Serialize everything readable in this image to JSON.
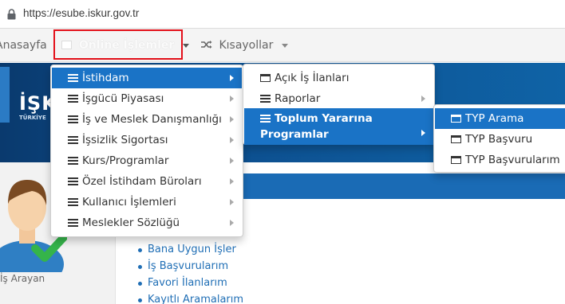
{
  "browser": {
    "url": "https://esube.iskur.gov.tr"
  },
  "navbar": {
    "home_label": "Anasayfa",
    "online_label": "Online İşlemler",
    "shortcuts_label": "Kısayollar"
  },
  "hero": {
    "logo_text": "İŞK",
    "logo_sub": "TÜRKİYE"
  },
  "sidebar": {
    "avatar_label": "İş Arayan"
  },
  "links": [
    "Bana Uygun İşler",
    "İş Başvurularım",
    "Favori İlanlarım",
    "Kayıtlı Aramalarım"
  ],
  "menu1": [
    {
      "label": "İstihdam",
      "active": true
    },
    {
      "label": "İşgücü Piyasası",
      "active": false
    },
    {
      "label": "İş ve Meslek Danışmanlığı",
      "active": false
    },
    {
      "label": "İşsizlik Sigortası",
      "active": false
    },
    {
      "label": "Kurs/Programlar",
      "active": false
    },
    {
      "label": "Özel İstihdam Büroları",
      "active": false
    },
    {
      "label": "Kullanıcı İşlemleri",
      "active": false
    },
    {
      "label": "Meslekler Sözlüğü",
      "active": false
    }
  ],
  "menu2": [
    {
      "label": "Açık İş İlanları"
    },
    {
      "label": "Raporlar"
    },
    {
      "label_line1": "Toplum Yararına",
      "label_line2": "Programlar"
    }
  ],
  "menu3": [
    {
      "label": "TYP Arama"
    },
    {
      "label": "TYP Başvuru"
    },
    {
      "label": "TYP Başvurularım"
    }
  ],
  "colors": {
    "accent": "#1a73c6",
    "highlight_border": "#e3101a",
    "link": "#1f6eb5"
  },
  "icons": {
    "lock": "lock-icon",
    "window": "window-icon",
    "shuffle": "shuffle-icon",
    "list": "list-icon",
    "table": "table-icon",
    "chevron_right": "chevron-right-icon"
  }
}
